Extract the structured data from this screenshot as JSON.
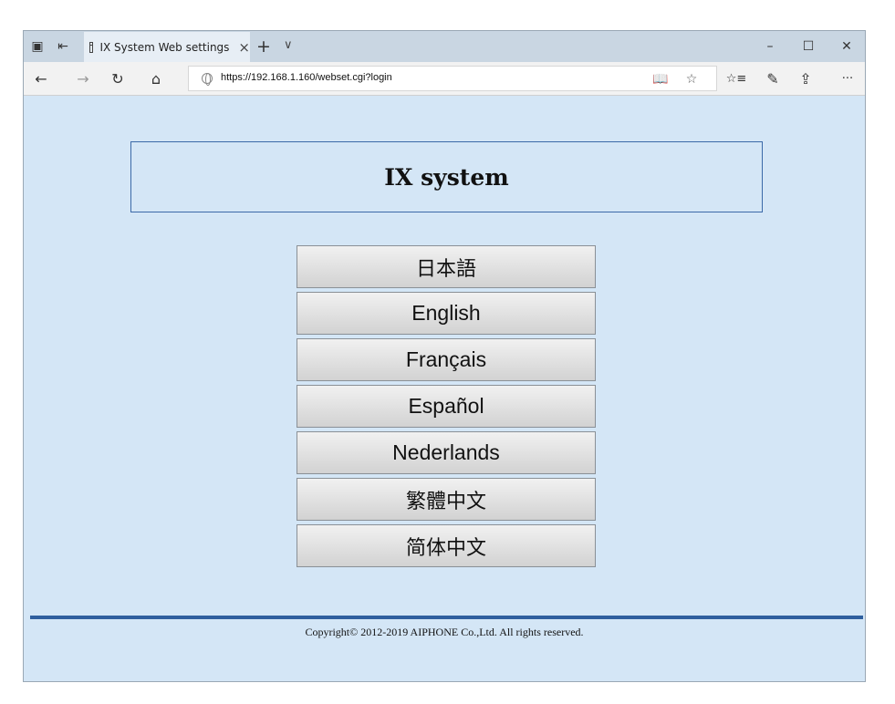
{
  "browser": {
    "tab_title": "IX System Web settings",
    "tab_close": "×",
    "new_tab": "+",
    "tab_list": "∨",
    "url": "https://192.168.1.160/webset.cgi?login",
    "window_controls": {
      "minimize": "–",
      "maximize": "☐",
      "close": "✕"
    },
    "nav": {
      "back": "←",
      "forward": "→",
      "refresh": "↻",
      "home": "⌂"
    },
    "toolbar": {
      "reading": "📖",
      "favorite": "☆",
      "favorites_list": "☆≡",
      "notes": "✎",
      "share": "⇪",
      "more": "···"
    },
    "tab_tools": {
      "tabs_aside": "▣",
      "restore_tabs": "⇤"
    }
  },
  "page": {
    "header_title": "IX system",
    "languages": [
      {
        "label": "日本語",
        "id": "japanese"
      },
      {
        "label": "English",
        "id": "english"
      },
      {
        "label": "Français",
        "id": "francais"
      },
      {
        "label": "Español",
        "id": "espanol"
      },
      {
        "label": "Nederlands",
        "id": "nederlands"
      },
      {
        "label": "繁體中文",
        "id": "traditional-chinese"
      },
      {
        "label": "简体中文",
        "id": "simplified-chinese"
      }
    ],
    "copyright": "Copyright© 2012-2019 AIPHONE Co.,Ltd. All rights reserved."
  },
  "colors": {
    "page_bg": "#d4e6f6",
    "accent_border": "#3b69a8",
    "footer_rule": "#2f5f9e"
  }
}
